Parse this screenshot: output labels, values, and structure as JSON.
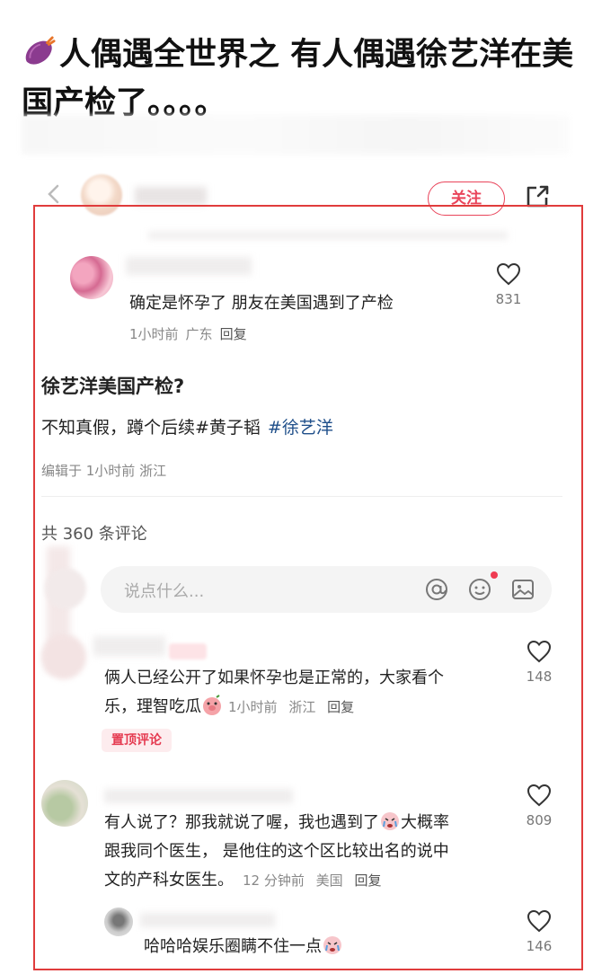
{
  "headline": "人偶遇全世界之 有人偶遇徐艺洋在美国产检了。。。。",
  "header": {
    "follow_label": "关注"
  },
  "top_comment": {
    "text": "确定是怀孕了 朋友在美国遇到了产检",
    "time": "1小时前",
    "location": "广东",
    "reply": "回复",
    "likes": "831"
  },
  "post": {
    "title": "徐艺洋美国产检?",
    "body": "不知真假，蹲个后续#黄子韬",
    "tag": "#徐艺洋",
    "edit_meta": "编辑于 1小时前 浙江"
  },
  "comments_header": {
    "count_text": "共 360 条评论"
  },
  "input": {
    "placeholder": "说点什么..."
  },
  "comments": [
    {
      "line1": "俩人已经公开了如果怀孕也是正常的，大家看个",
      "line2": "乐，理智吃瓜",
      "time": "1小时前",
      "location": "浙江",
      "reply": "回复",
      "badge": "置顶评论",
      "likes": "148"
    },
    {
      "line1": "有人说了？那我就说了喔，我也遇到了",
      "line1b": "大概率",
      "line2": "跟我同个医生， 是他住的这个区比较出名的说中",
      "line3": "文的产科女医生。",
      "time": "12 分钟前",
      "location": "美国",
      "reply": "回复",
      "likes": "809"
    },
    {
      "line1": "哈哈哈娱乐圈瞒不住一点",
      "likes": "146"
    }
  ],
  "colors": {
    "accent": "#e9445a",
    "frame": "#e03c3c",
    "tag_blue": "#1f4f8a"
  },
  "icons": [
    "sweet-potato-icon",
    "back-icon",
    "share-icon",
    "heart-icon",
    "at-icon",
    "emoji-icon",
    "image-icon",
    "crying-emoji-icon",
    "pig-emoji-icon"
  ]
}
